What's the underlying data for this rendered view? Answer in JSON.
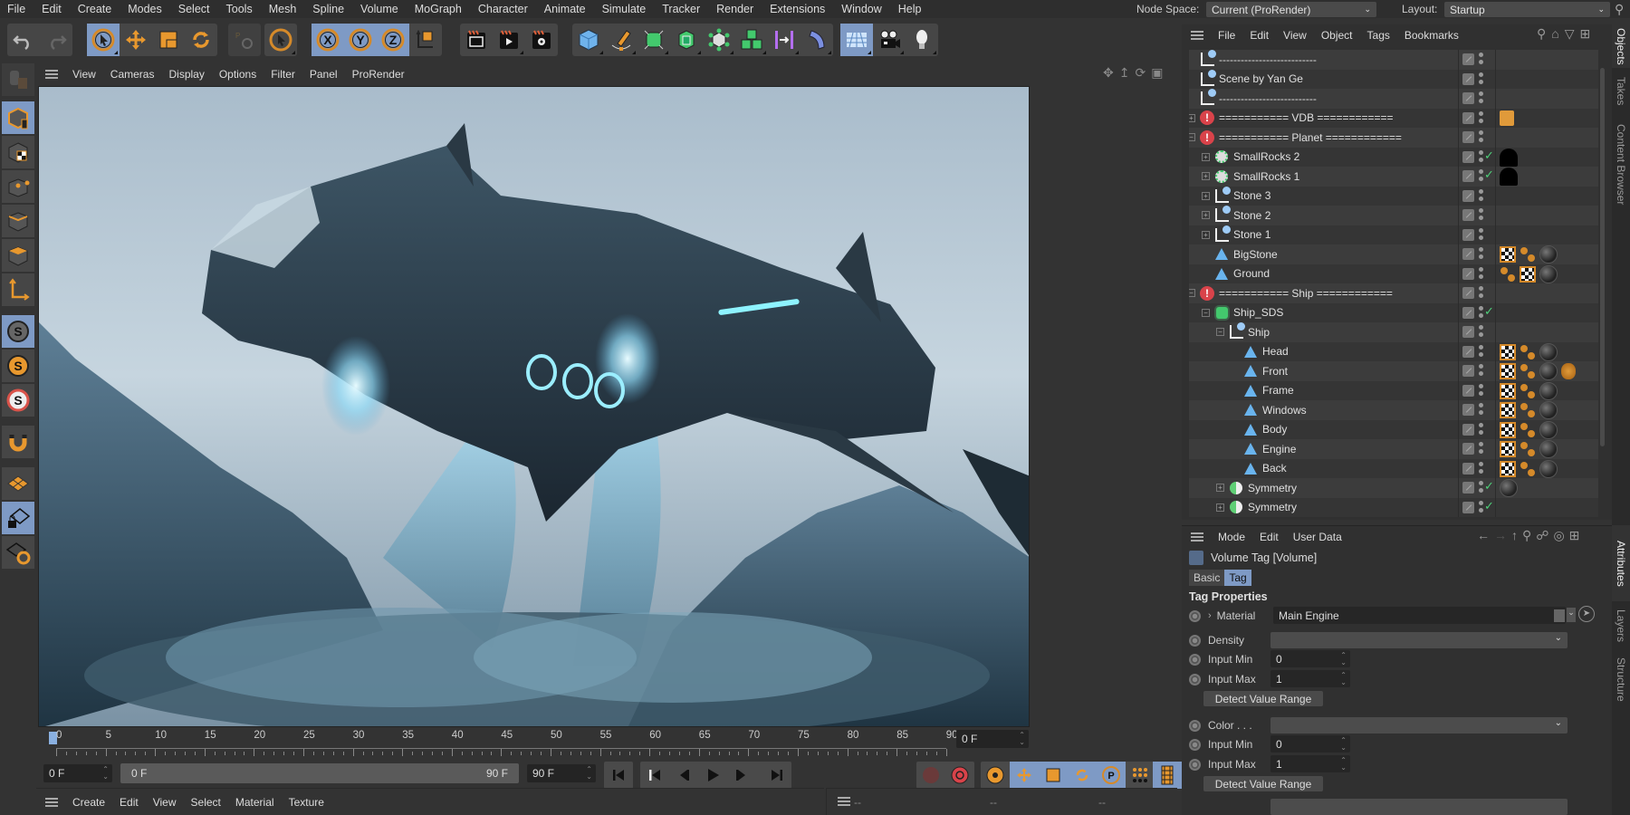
{
  "menubar": {
    "items": [
      "File",
      "Edit",
      "Create",
      "Modes",
      "Select",
      "Tools",
      "Mesh",
      "Spline",
      "Volume",
      "MoGraph",
      "Character",
      "Animate",
      "Simulate",
      "Tracker",
      "Render",
      "Extensions",
      "Window",
      "Help"
    ],
    "node_space_label": "Node Space:",
    "node_space_value": "Current (ProRender)",
    "layout_label": "Layout:",
    "layout_value": "Startup"
  },
  "toolbar": {
    "groups": [
      [
        "undo-icon",
        "redo-icon"
      ],
      [
        "live-selection-icon",
        "move-icon",
        "scale-icon",
        "rotate-icon"
      ],
      [
        "recent-tools-icon"
      ],
      [
        "model-mode-icon"
      ],
      [
        "lock-x-icon",
        "lock-y-icon",
        "lock-z-icon",
        "coordinate-system-icon"
      ],
      [
        "render-view-icon",
        "render-picture-viewer-icon",
        "render-settings-icon"
      ],
      [
        "cube-icon",
        "pen-icon",
        "subdivision-icon",
        "extrude-icon",
        "cloner-icon",
        "mograph-fracture-icon",
        "symmetry-deformer-icon",
        "bend-deformer-icon"
      ],
      [
        "floor-icon",
        "camera-icon",
        "light-icon"
      ]
    ]
  },
  "viewport": {
    "menu": [
      "View",
      "Cameras",
      "Display",
      "Options",
      "Filter",
      "Panel",
      "ProRender"
    ],
    "nav_icons": [
      "pan-icon",
      "dolly-icon",
      "orbit-icon",
      "maximize-view-icon"
    ]
  },
  "lefttools": [
    "make-editable-icon",
    "object-mode-icon",
    "texture-mode-icon",
    "points-mode-icon",
    "edges-mode-icon",
    "polygons-mode-icon",
    "axis-mode-icon",
    "snap-icon",
    "snap-settings-icon",
    "workplane-snap-icon",
    "magnet-icon",
    "workplane-icon",
    "locked-workplane-icon",
    "align-workplane-icon"
  ],
  "timeline": {
    "ticks": [
      "0",
      "5",
      "10",
      "15",
      "20",
      "25",
      "30",
      "35",
      "40",
      "45",
      "50",
      "55",
      "60",
      "65",
      "70",
      "75",
      "80",
      "85",
      "90"
    ],
    "current_frame": "0 F",
    "start_frame": "0 F",
    "range_start": "0 F",
    "range_end": "90 F",
    "end_frame": "90 F"
  },
  "material_manager": {
    "menu": [
      "Create",
      "Edit",
      "View",
      "Select",
      "Material",
      "Texture"
    ]
  },
  "coord_manager": {
    "placeholders": [
      "--",
      "--",
      "--"
    ]
  },
  "object_manager": {
    "menu": [
      "File",
      "Edit",
      "View",
      "Object",
      "Tags",
      "Bookmarks"
    ],
    "rows": [
      {
        "name": "---------------------------",
        "icon": "null",
        "depth": 0,
        "tags": []
      },
      {
        "name": "Scene by Yan Ge",
        "icon": "null",
        "depth": 0,
        "tags": []
      },
      {
        "name": "---------------------------",
        "icon": "null",
        "depth": 0,
        "tags": []
      },
      {
        "name": "=========== VDB ============",
        "icon": "warn",
        "depth": 0,
        "expand": "+",
        "tags": [
          "note"
        ]
      },
      {
        "name": "=========== Planet ============",
        "icon": "warn",
        "depth": 0,
        "expand": "-",
        "tags": []
      },
      {
        "name": "SmallRocks 2",
        "icon": "cloner",
        "depth": 1,
        "expand": "+",
        "check": true,
        "tags": [
          "black"
        ]
      },
      {
        "name": "SmallRocks 1",
        "icon": "cloner",
        "depth": 1,
        "expand": "+",
        "check": true,
        "tags": [
          "black"
        ]
      },
      {
        "name": "Stone 3",
        "icon": "null",
        "depth": 1,
        "expand": "+",
        "tags": []
      },
      {
        "name": "Stone 2",
        "icon": "null",
        "depth": 1,
        "expand": "+",
        "tags": []
      },
      {
        "name": "Stone 1",
        "icon": "null",
        "depth": 1,
        "expand": "+",
        "tags": []
      },
      {
        "name": "BigStone",
        "icon": "poly",
        "depth": 1,
        "tags": [
          "checker",
          "dots",
          "sphere"
        ]
      },
      {
        "name": "Ground",
        "icon": "poly",
        "depth": 1,
        "tags": [
          "dots",
          "checker",
          "sphere"
        ]
      },
      {
        "name": "=========== Ship ============",
        "icon": "warn",
        "depth": 0,
        "expand": "-",
        "tags": []
      },
      {
        "name": "Ship_SDS",
        "icon": "sds",
        "depth": 1,
        "expand": "-",
        "check": true,
        "tags": []
      },
      {
        "name": "Ship",
        "icon": "null",
        "depth": 2,
        "expand": "-",
        "tags": []
      },
      {
        "name": "Head",
        "icon": "poly",
        "depth": 3,
        "tags": [
          "checker",
          "dots",
          "sphere"
        ]
      },
      {
        "name": "Front",
        "icon": "poly",
        "depth": 3,
        "tags": [
          "checker",
          "dots",
          "sphere",
          "bug"
        ]
      },
      {
        "name": "Frame",
        "icon": "poly",
        "depth": 3,
        "tags": [
          "checker",
          "dots",
          "sphere"
        ]
      },
      {
        "name": "Windows",
        "icon": "poly",
        "depth": 3,
        "tags": [
          "checker",
          "dots",
          "sphere"
        ]
      },
      {
        "name": "Body",
        "icon": "poly",
        "depth": 3,
        "tags": [
          "checker",
          "dots",
          "sphere"
        ]
      },
      {
        "name": "Engine",
        "icon": "poly",
        "depth": 3,
        "tags": [
          "checker",
          "dots",
          "sphere"
        ]
      },
      {
        "name": "Back",
        "icon": "poly",
        "depth": 3,
        "tags": [
          "checker",
          "dots",
          "sphere"
        ]
      },
      {
        "name": "Symmetry",
        "icon": "sym",
        "depth": 2,
        "expand": "+",
        "check": true,
        "tags": [
          "sphere"
        ]
      },
      {
        "name": "Symmetry",
        "icon": "sym",
        "depth": 2,
        "expand": "+",
        "check": true,
        "tags": []
      }
    ]
  },
  "side_tabs_top": [
    "Objects",
    "Takes",
    "Content Browser"
  ],
  "side_tabs_bottom": [
    "Attributes",
    "Layers",
    "Structure"
  ],
  "attributes": {
    "menu": [
      "Mode",
      "Edit",
      "User Data"
    ],
    "title": "Volume Tag [Volume]",
    "tabs": [
      "Basic",
      "Tag"
    ],
    "active_tab": "Tag",
    "section": "Tag Properties",
    "material_label": "Material",
    "material_value": "Main Engine",
    "density_label": "Density",
    "density_value": "",
    "density_input_min_label": "Input Min",
    "density_input_min": "0",
    "density_input_max_label": "Input Max",
    "density_input_max": "1",
    "detect_label": "Detect Value Range",
    "color_label": "Color . . .",
    "color_value": "",
    "color_input_min_label": "Input Min",
    "color_input_min": "0",
    "color_input_max_label": "Input Max",
    "color_input_max": "1",
    "detect_label_2": "Detect Value Range"
  }
}
